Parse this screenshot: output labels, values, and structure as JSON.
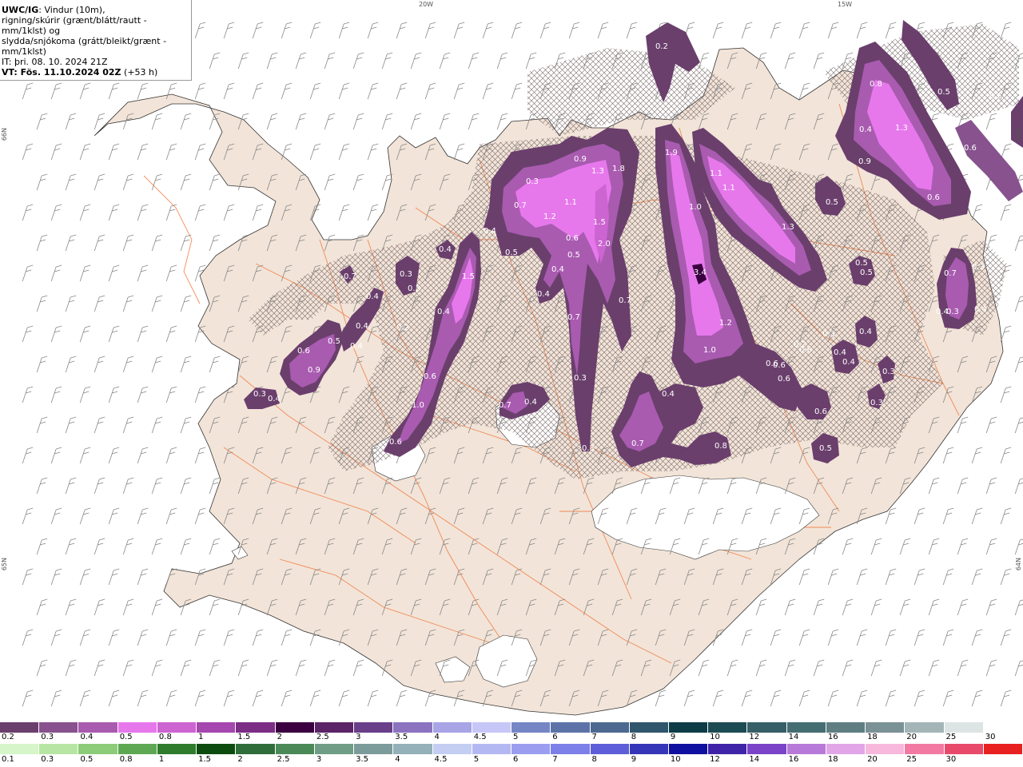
{
  "header": {
    "model": "UWC/IG",
    "desc1": ": Vindur (10m),",
    "desc2": "rigning/skúrir (grænt/blátt/rautt - mm/1klst) og",
    "desc3": "slydda/snjókoma (grátt/bleikt/grænt - mm/1klst)",
    "it": "IT: þri. 08. 10. 2024 21Z",
    "vt": "VT: Fös. 11.10.2024 02Z",
    "lead": " (+53 h)"
  },
  "coords": {
    "top1": "20W",
    "top2": "15W",
    "left1": "66N",
    "left2": "65N",
    "right1": "66N",
    "right2": "64N"
  },
  "colors": {
    "land": "#f2e4d8",
    "sea": "#ffffff",
    "roads": "#f07a40",
    "hatch": "#7a6a6a"
  },
  "snow_legend": {
    "colors": [
      "#6a3f6c",
      "#87528d",
      "#a95bb0",
      "#e778ec",
      "#cc64d1",
      "#a547ae",
      "#7c2d86",
      "#3a0040",
      "#5b2466",
      "#6a3f8a",
      "#8b73c0",
      "#a8a4e6",
      "#c7c7f7",
      "#7686c5",
      "#5d73a8",
      "#4d6990",
      "#30566d",
      "#0d3c46",
      "#1d4b53",
      "#375f67",
      "#456e72",
      "#5f7e82",
      "#7a9196",
      "#a4b5b8",
      "#dde4e4",
      "#ffffff"
    ],
    "labels": [
      "0.2",
      "0.3",
      "0.4",
      "0.5",
      "0.8",
      "1",
      "1.5",
      "2",
      "2.5",
      "3",
      "3.5",
      "4",
      "4.5",
      "5",
      "6",
      "7",
      "8",
      "9",
      "10",
      "12",
      "14",
      "16",
      "18",
      "20",
      "25",
      "30"
    ]
  },
  "rain_legend": {
    "colors": [
      "#d6f5c8",
      "#b7e6a4",
      "#8ccc78",
      "#5ea854",
      "#2f7c2d",
      "#0d4c0f",
      "#2f6e3a",
      "#4b8a58",
      "#6f9d86",
      "#7b9c9a",
      "#94b0b8",
      "#c4cdf2",
      "#b4b8f2",
      "#9b9ef0",
      "#7d80e8",
      "#5e5fd8",
      "#3536b8",
      "#1010a0",
      "#3f24a8",
      "#7a44c8",
      "#b87ad8",
      "#e2a6e8",
      "#f7b8dc",
      "#f27aa2",
      "#e84a6c",
      "#e82020"
    ],
    "labels": [
      "0.1",
      "0.3",
      "0.5",
      "0.8",
      "1",
      "1.5",
      "2",
      "2.5",
      "3",
      "3.5",
      "4",
      "4.5",
      "5",
      "6",
      "7",
      "8",
      "9",
      "10",
      "12",
      "14",
      "16",
      "18",
      "20",
      "25",
      "30",
      ""
    ]
  },
  "precip_values": [
    {
      "t": "0.2",
      "c": "p1"
    },
    {
      "t": "0.8",
      "c": "p2"
    },
    {
      "t": "0.5",
      "c": "p3"
    },
    {
      "t": "0.4",
      "c": "p4"
    },
    {
      "t": "1.3",
      "c": "p5"
    },
    {
      "t": "0.9",
      "c": "p6"
    },
    {
      "t": "0.6",
      "c": "p7"
    },
    {
      "t": "0.5",
      "c": "p8"
    },
    {
      "t": "0.6",
      "c": "p9"
    },
    {
      "t": "1.9",
      "c": "p10"
    },
    {
      "t": "1.1",
      "c": "p11"
    },
    {
      "t": "1.1",
      "c": "p12"
    },
    {
      "t": "1.0",
      "c": "p13"
    },
    {
      "t": "1.3",
      "c": "p14"
    },
    {
      "t": "0.5",
      "c": "p15"
    },
    {
      "t": "0.5",
      "c": "p16"
    },
    {
      "t": "0.7",
      "c": "p17"
    },
    {
      "t": "0.3",
      "c": "p18"
    },
    {
      "t": "0.4",
      "c": "p19"
    },
    {
      "t": "3.4",
      "c": "p20"
    },
    {
      "t": "1.2",
      "c": "p21"
    },
    {
      "t": "1.0",
      "c": "p22"
    },
    {
      "t": "0.4",
      "c": "p23"
    },
    {
      "t": "0.3",
      "c": "p24"
    },
    {
      "t": "0.4",
      "c": "p25"
    },
    {
      "t": "0.2",
      "c": "p26"
    },
    {
      "t": "0.4",
      "c": "p27"
    },
    {
      "t": "0.6",
      "c": "p28"
    },
    {
      "t": "0.6",
      "c": "p29"
    },
    {
      "t": "0.3",
      "c": "p30"
    },
    {
      "t": "0.3",
      "c": "p31"
    },
    {
      "t": "0.6",
      "c": "p32"
    },
    {
      "t": "0.5",
      "c": "p33"
    },
    {
      "t": "0.4",
      "c": "p34"
    },
    {
      "t": "0.8",
      "c": "p35"
    },
    {
      "t": "0.7",
      "c": "p36"
    },
    {
      "t": "0.4",
      "c": "p37"
    },
    {
      "t": "0.3",
      "c": "p38"
    },
    {
      "t": "0.7",
      "c": "p39"
    },
    {
      "t": "0.9",
      "c": "p40"
    },
    {
      "t": "1.3",
      "c": "p41"
    },
    {
      "t": "1.8",
      "c": "p42"
    },
    {
      "t": "0.7",
      "c": "p43"
    },
    {
      "t": "1.2",
      "c": "p44"
    },
    {
      "t": "1.1",
      "c": "p45"
    },
    {
      "t": "1.5",
      "c": "p46"
    },
    {
      "t": "0.6",
      "c": "p47"
    },
    {
      "t": "0.5",
      "c": "p48"
    },
    {
      "t": "2.0",
      "c": "p49"
    },
    {
      "t": "0.4",
      "c": "p50"
    },
    {
      "t": "0.4",
      "c": "p51"
    },
    {
      "t": "0.7",
      "c": "p52"
    },
    {
      "t": "0.7",
      "c": "p53"
    },
    {
      "t": "0.3",
      "c": "p54"
    },
    {
      "t": "0.3",
      "c": "p55"
    },
    {
      "t": "0.5",
      "c": "p56"
    },
    {
      "t": "0.4",
      "c": "p57"
    },
    {
      "t": "0.4",
      "c": "p58"
    },
    {
      "t": "0.4",
      "c": "p59"
    },
    {
      "t": "1.5",
      "c": "p60"
    },
    {
      "t": "0.3",
      "c": "p61"
    },
    {
      "t": "0.3",
      "c": "p62"
    },
    {
      "t": "0.2",
      "c": "p63"
    },
    {
      "t": "0.4",
      "c": "p64"
    },
    {
      "t": "0.6",
      "c": "p65"
    },
    {
      "t": "1.0",
      "c": "p66"
    },
    {
      "t": "0.6",
      "c": "p67"
    },
    {
      "t": "0.7",
      "c": "p68"
    },
    {
      "t": "0.4",
      "c": "p69"
    },
    {
      "t": "0.5",
      "c": "p70"
    },
    {
      "t": "0.6",
      "c": "p71"
    },
    {
      "t": "0.9",
      "c": "p72"
    },
    {
      "t": "0.4",
      "c": "p73"
    },
    {
      "t": "0.3",
      "c": "p74"
    },
    {
      "t": "0.4",
      "c": "p75"
    },
    {
      "t": "0.3",
      "c": "p76"
    },
    {
      "t": "0.4",
      "c": "p77"
    },
    {
      "t": "0.6",
      "c": "p78"
    },
    {
      "t": "0.6",
      "c": "p79"
    },
    {
      "t": "0.5",
      "c": "p80"
    }
  ]
}
